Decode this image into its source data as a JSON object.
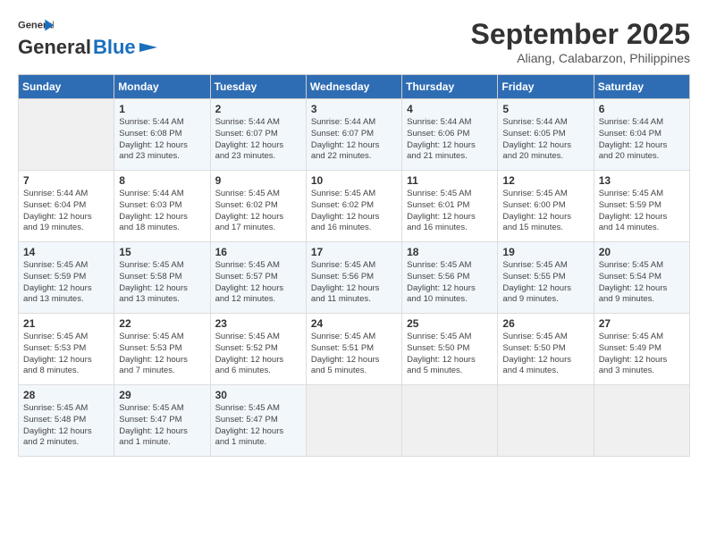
{
  "header": {
    "logo_line1": "General",
    "logo_line2": "Blue",
    "month": "September 2025",
    "location": "Aliang, Calabarzon, Philippines"
  },
  "days_of_week": [
    "Sunday",
    "Monday",
    "Tuesday",
    "Wednesday",
    "Thursday",
    "Friday",
    "Saturday"
  ],
  "weeks": [
    [
      {
        "day": "",
        "info": ""
      },
      {
        "day": "1",
        "info": "Sunrise: 5:44 AM\nSunset: 6:08 PM\nDaylight: 12 hours\nand 23 minutes."
      },
      {
        "day": "2",
        "info": "Sunrise: 5:44 AM\nSunset: 6:07 PM\nDaylight: 12 hours\nand 23 minutes."
      },
      {
        "day": "3",
        "info": "Sunrise: 5:44 AM\nSunset: 6:07 PM\nDaylight: 12 hours\nand 22 minutes."
      },
      {
        "day": "4",
        "info": "Sunrise: 5:44 AM\nSunset: 6:06 PM\nDaylight: 12 hours\nand 21 minutes."
      },
      {
        "day": "5",
        "info": "Sunrise: 5:44 AM\nSunset: 6:05 PM\nDaylight: 12 hours\nand 20 minutes."
      },
      {
        "day": "6",
        "info": "Sunrise: 5:44 AM\nSunset: 6:04 PM\nDaylight: 12 hours\nand 20 minutes."
      }
    ],
    [
      {
        "day": "7",
        "info": "Sunrise: 5:44 AM\nSunset: 6:04 PM\nDaylight: 12 hours\nand 19 minutes."
      },
      {
        "day": "8",
        "info": "Sunrise: 5:44 AM\nSunset: 6:03 PM\nDaylight: 12 hours\nand 18 minutes."
      },
      {
        "day": "9",
        "info": "Sunrise: 5:45 AM\nSunset: 6:02 PM\nDaylight: 12 hours\nand 17 minutes."
      },
      {
        "day": "10",
        "info": "Sunrise: 5:45 AM\nSunset: 6:02 PM\nDaylight: 12 hours\nand 16 minutes."
      },
      {
        "day": "11",
        "info": "Sunrise: 5:45 AM\nSunset: 6:01 PM\nDaylight: 12 hours\nand 16 minutes."
      },
      {
        "day": "12",
        "info": "Sunrise: 5:45 AM\nSunset: 6:00 PM\nDaylight: 12 hours\nand 15 minutes."
      },
      {
        "day": "13",
        "info": "Sunrise: 5:45 AM\nSunset: 5:59 PM\nDaylight: 12 hours\nand 14 minutes."
      }
    ],
    [
      {
        "day": "14",
        "info": "Sunrise: 5:45 AM\nSunset: 5:59 PM\nDaylight: 12 hours\nand 13 minutes."
      },
      {
        "day": "15",
        "info": "Sunrise: 5:45 AM\nSunset: 5:58 PM\nDaylight: 12 hours\nand 13 minutes."
      },
      {
        "day": "16",
        "info": "Sunrise: 5:45 AM\nSunset: 5:57 PM\nDaylight: 12 hours\nand 12 minutes."
      },
      {
        "day": "17",
        "info": "Sunrise: 5:45 AM\nSunset: 5:56 PM\nDaylight: 12 hours\nand 11 minutes."
      },
      {
        "day": "18",
        "info": "Sunrise: 5:45 AM\nSunset: 5:56 PM\nDaylight: 12 hours\nand 10 minutes."
      },
      {
        "day": "19",
        "info": "Sunrise: 5:45 AM\nSunset: 5:55 PM\nDaylight: 12 hours\nand 9 minutes."
      },
      {
        "day": "20",
        "info": "Sunrise: 5:45 AM\nSunset: 5:54 PM\nDaylight: 12 hours\nand 9 minutes."
      }
    ],
    [
      {
        "day": "21",
        "info": "Sunrise: 5:45 AM\nSunset: 5:53 PM\nDaylight: 12 hours\nand 8 minutes."
      },
      {
        "day": "22",
        "info": "Sunrise: 5:45 AM\nSunset: 5:53 PM\nDaylight: 12 hours\nand 7 minutes."
      },
      {
        "day": "23",
        "info": "Sunrise: 5:45 AM\nSunset: 5:52 PM\nDaylight: 12 hours\nand 6 minutes."
      },
      {
        "day": "24",
        "info": "Sunrise: 5:45 AM\nSunset: 5:51 PM\nDaylight: 12 hours\nand 5 minutes."
      },
      {
        "day": "25",
        "info": "Sunrise: 5:45 AM\nSunset: 5:50 PM\nDaylight: 12 hours\nand 5 minutes."
      },
      {
        "day": "26",
        "info": "Sunrise: 5:45 AM\nSunset: 5:50 PM\nDaylight: 12 hours\nand 4 minutes."
      },
      {
        "day": "27",
        "info": "Sunrise: 5:45 AM\nSunset: 5:49 PM\nDaylight: 12 hours\nand 3 minutes."
      }
    ],
    [
      {
        "day": "28",
        "info": "Sunrise: 5:45 AM\nSunset: 5:48 PM\nDaylight: 12 hours\nand 2 minutes."
      },
      {
        "day": "29",
        "info": "Sunrise: 5:45 AM\nSunset: 5:47 PM\nDaylight: 12 hours\nand 1 minute."
      },
      {
        "day": "30",
        "info": "Sunrise: 5:45 AM\nSunset: 5:47 PM\nDaylight: 12 hours\nand 1 minute."
      },
      {
        "day": "",
        "info": ""
      },
      {
        "day": "",
        "info": ""
      },
      {
        "day": "",
        "info": ""
      },
      {
        "day": "",
        "info": ""
      }
    ]
  ]
}
